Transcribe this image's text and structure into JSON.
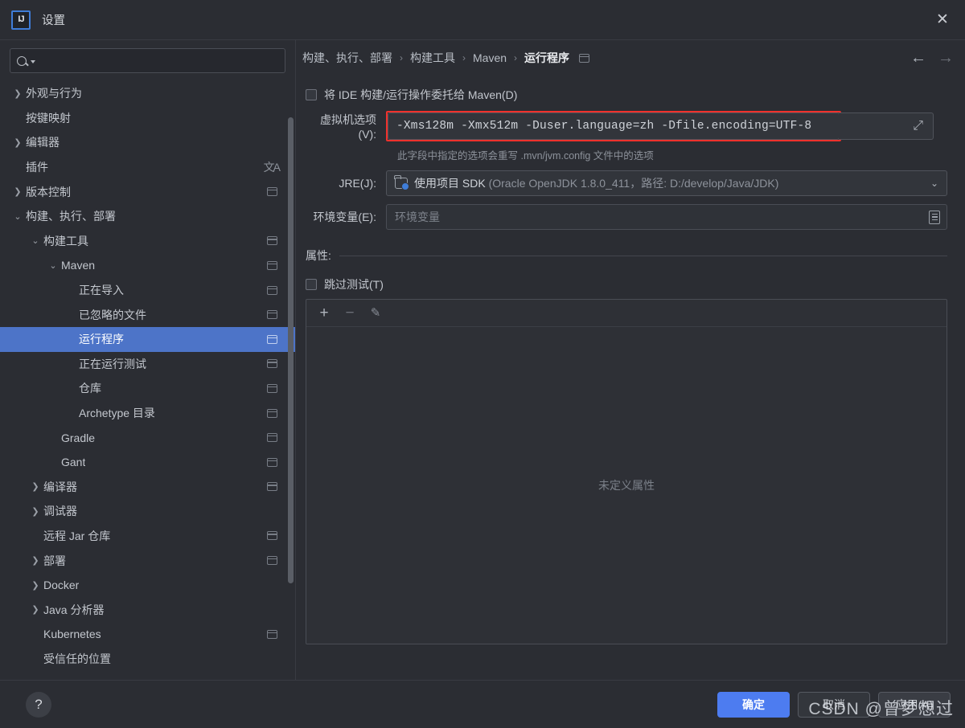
{
  "window": {
    "title": "设置",
    "logo_text": "IJ",
    "close_icon": "✕"
  },
  "search": {
    "placeholder": "",
    "value": ""
  },
  "sidebar": {
    "items": [
      {
        "label": "外观与行为",
        "indent": 0,
        "arrow": "›",
        "badge": false,
        "selected": false
      },
      {
        "label": "按键映射",
        "indent": 0,
        "arrow": "",
        "badge": false,
        "selected": false
      },
      {
        "label": "编辑器",
        "indent": 0,
        "arrow": "›",
        "badge": false,
        "selected": false
      },
      {
        "label": "插件",
        "indent": 0,
        "arrow": "",
        "badge": false,
        "selected": false,
        "trans": "文A"
      },
      {
        "label": "版本控制",
        "indent": 0,
        "arrow": "›",
        "badge": true,
        "selected": false
      },
      {
        "label": "构建、执行、部署",
        "indent": 0,
        "arrow": "⌄",
        "badge": false,
        "selected": false
      },
      {
        "label": "构建工具",
        "indent": 1,
        "arrow": "⌄",
        "badge": true,
        "selected": false
      },
      {
        "label": "Maven",
        "indent": 2,
        "arrow": "⌄",
        "badge": true,
        "selected": false
      },
      {
        "label": "正在导入",
        "indent": 3,
        "arrow": "",
        "badge": true,
        "selected": false
      },
      {
        "label": "已忽略的文件",
        "indent": 3,
        "arrow": "",
        "badge": true,
        "selected": false
      },
      {
        "label": "运行程序",
        "indent": 3,
        "arrow": "",
        "badge": true,
        "selected": true
      },
      {
        "label": "正在运行测试",
        "indent": 3,
        "arrow": "",
        "badge": true,
        "selected": false
      },
      {
        "label": "仓库",
        "indent": 3,
        "arrow": "",
        "badge": true,
        "selected": false
      },
      {
        "label": "Archetype 目录",
        "indent": 3,
        "arrow": "",
        "badge": true,
        "selected": false
      },
      {
        "label": "Gradle",
        "indent": 2,
        "arrow": "",
        "badge": true,
        "selected": false
      },
      {
        "label": "Gant",
        "indent": 2,
        "arrow": "",
        "badge": true,
        "selected": false
      },
      {
        "label": "编译器",
        "indent": 1,
        "arrow": "›",
        "badge": true,
        "selected": false
      },
      {
        "label": "调试器",
        "indent": 1,
        "arrow": "›",
        "badge": false,
        "selected": false
      },
      {
        "label": "远程 Jar 仓库",
        "indent": 1,
        "arrow": "",
        "badge": true,
        "selected": false
      },
      {
        "label": "部署",
        "indent": 1,
        "arrow": "›",
        "badge": true,
        "selected": false
      },
      {
        "label": "Docker",
        "indent": 1,
        "arrow": "›",
        "badge": false,
        "selected": false
      },
      {
        "label": "Java 分析器",
        "indent": 1,
        "arrow": "›",
        "badge": false,
        "selected": false
      },
      {
        "label": "Kubernetes",
        "indent": 1,
        "arrow": "",
        "badge": true,
        "selected": false
      },
      {
        "label": "受信任的位置",
        "indent": 1,
        "arrow": "",
        "badge": false,
        "selected": false
      }
    ]
  },
  "breadcrumb": {
    "items": [
      "构建、执行、部署",
      "构建工具",
      "Maven",
      "运行程序"
    ],
    "separator": "›"
  },
  "nav": {
    "back_icon": "←",
    "forward_icon": "→"
  },
  "main": {
    "delegate_checkbox_label": "将 IDE 构建/运行操作委托给 Maven(D)",
    "vm_options_label": "虚拟机选项(V):",
    "vm_options_value": "-Xms128m -Xmx512m -Duser.language=zh -Dfile.encoding=UTF-8",
    "vm_options_hint": "此字段中指定的选项会重写 .mvn/jvm.config 文件中的选项",
    "jre_label": "JRE(J):",
    "jre_value_main": "使用项目 SDK",
    "jre_value_detail": "(Oracle OpenJDK 1.8.0_411，路径: D:/develop/Java/JDK)",
    "env_label": "环境变量(E):",
    "env_placeholder": "环境变量",
    "properties_label": "属性:",
    "skip_tests_label": "跳过测试(T)",
    "table_empty_text": "未定义属性",
    "toolbar": {
      "add_icon": "+",
      "remove_icon": "−",
      "edit_icon": "✎"
    }
  },
  "footer": {
    "help_icon": "?",
    "ok_label": "确定",
    "cancel_label": "取消",
    "apply_label": "应用(A)"
  },
  "watermark": "CSDN @曾梦想过",
  "colors": {
    "background": "#2b2d33",
    "selection_blue": "#4d74c8",
    "primary_button": "#4d7cf0",
    "highlight_red": "#f0312c",
    "text": "#c3c7ce",
    "muted_text": "#8d929b"
  }
}
